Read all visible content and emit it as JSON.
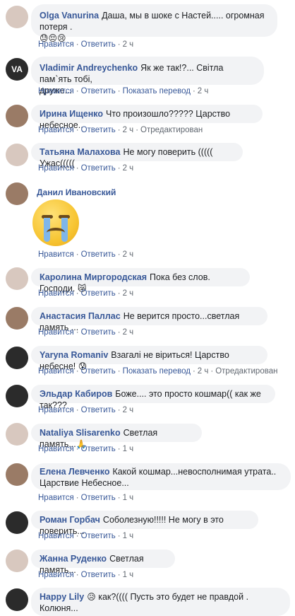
{
  "common": {
    "like": "Нравится",
    "reply": "Ответить",
    "translate": "Показать перевод",
    "edited": "Отредактирован"
  },
  "comments": [
    {
      "name": "Olga Vanurina",
      "text": "Даша, мы в шоке с Настей..... огромная потеря .",
      "emoji": "😓😔😢",
      "time": "2 ч"
    },
    {
      "name": "Vladimir Andreychenko",
      "text": "Як же так!?... Світла пам`ять тобі,",
      "text2": "друже...",
      "time": "2 ч"
    },
    {
      "name": "Ирина Ищенко",
      "text": "Что произошло????? Царство небесное..",
      "time": "2 ч"
    },
    {
      "name": "Татьяна Малахова",
      "text": "Не могу поверить ((((( Ужас(((((",
      "time": "2 ч"
    },
    {
      "name": "Данил Ивановский",
      "time": "2 ч"
    },
    {
      "name": "Каролина Миргородская",
      "text": "Пока без слов. Господи.",
      "emoji": "😿",
      "time": "2 ч"
    },
    {
      "name": "Анастасия Паллас",
      "text": "Не верится просто...светлая память ...",
      "time": "2 ч"
    },
    {
      "name": "Yaryna Romaniv",
      "text": "Взагалі не віриться! Царство небесне!",
      "emoji": "😰",
      "time": "2 ч"
    },
    {
      "name": "Эльдар Кабиров",
      "text": "Боже.... это просто кошмар(( как же так???",
      "time": "2 ч"
    },
    {
      "name": "Nataliya Slisarenko",
      "text": "Светлая память...",
      "emoji": "🙏",
      "time": "1 ч"
    },
    {
      "name": "Елена Левченко",
      "text": "Какой кошмар...невосполнимая утрата..",
      "text2": "Царствие Небесное...",
      "time": "1 ч"
    },
    {
      "name": "Роман Горбач",
      "text": "Соболезную!!!!! Не могу в это поверить...",
      "time": "1 ч"
    },
    {
      "name": "Жанна Руденко",
      "text": "Светлая память...",
      "time": "1 ч"
    },
    {
      "name": "Happy Lily",
      "emoji": "😥",
      "text": "как?(((( Пусть это будет не правдой . Колюня..."
    }
  ]
}
